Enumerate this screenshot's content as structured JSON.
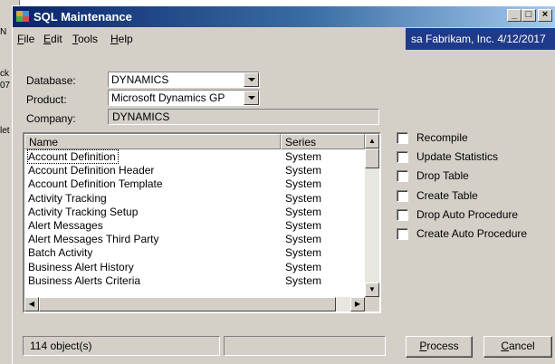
{
  "window": {
    "title": "SQL Maintenance",
    "min_glyph": "_",
    "max_glyph": "□",
    "close_glyph": "×"
  },
  "background_fragments": [
    "N",
    "ck",
    "07",
    "let"
  ],
  "menu": [
    {
      "first": "F",
      "rest": "ile"
    },
    {
      "first": "E",
      "rest": "dit"
    },
    {
      "first": "T",
      "rest": "ools"
    },
    {
      "first": "H",
      "rest": "elp"
    }
  ],
  "user_bar": "sa  Fabrikam, Inc.  4/12/2017",
  "form": {
    "database_label": "Database:",
    "database_value": "DYNAMICS",
    "product_label": "Product:",
    "product_value": "Microsoft Dynamics GP",
    "company_label": "Company:",
    "company_value": "DYNAMICS"
  },
  "table": {
    "columns": [
      "Name",
      "Series"
    ],
    "rows": [
      {
        "name": "Account Definition",
        "series": "System"
      },
      {
        "name": "Account Definition Header",
        "series": "System"
      },
      {
        "name": "Account Definition Template",
        "series": "System"
      },
      {
        "name": "Activity Tracking",
        "series": "System"
      },
      {
        "name": "Activity Tracking Setup",
        "series": "System"
      },
      {
        "name": "Alert Messages",
        "series": "System"
      },
      {
        "name": "Alert Messages Third Party",
        "series": "System"
      },
      {
        "name": "Batch Activity",
        "series": "System"
      },
      {
        "name": "Business Alert History",
        "series": "System"
      },
      {
        "name": "Business Alerts Criteria",
        "series": "System"
      }
    ]
  },
  "options": [
    "Recompile",
    "Update Statistics",
    "Drop Table",
    "Create Table",
    "Drop Auto Procedure",
    "Create Auto Procedure"
  ],
  "status": "114 object(s)",
  "buttons": {
    "process_first": "P",
    "process_rest": "rocess",
    "cancel_first": "C",
    "cancel_rest": "ancel"
  },
  "colors": {
    "title_gradient_start": "#0a246a",
    "title_gradient_end": "#a6caf0",
    "user_bar": "#1f3a8a",
    "face": "#d4d0c8"
  }
}
